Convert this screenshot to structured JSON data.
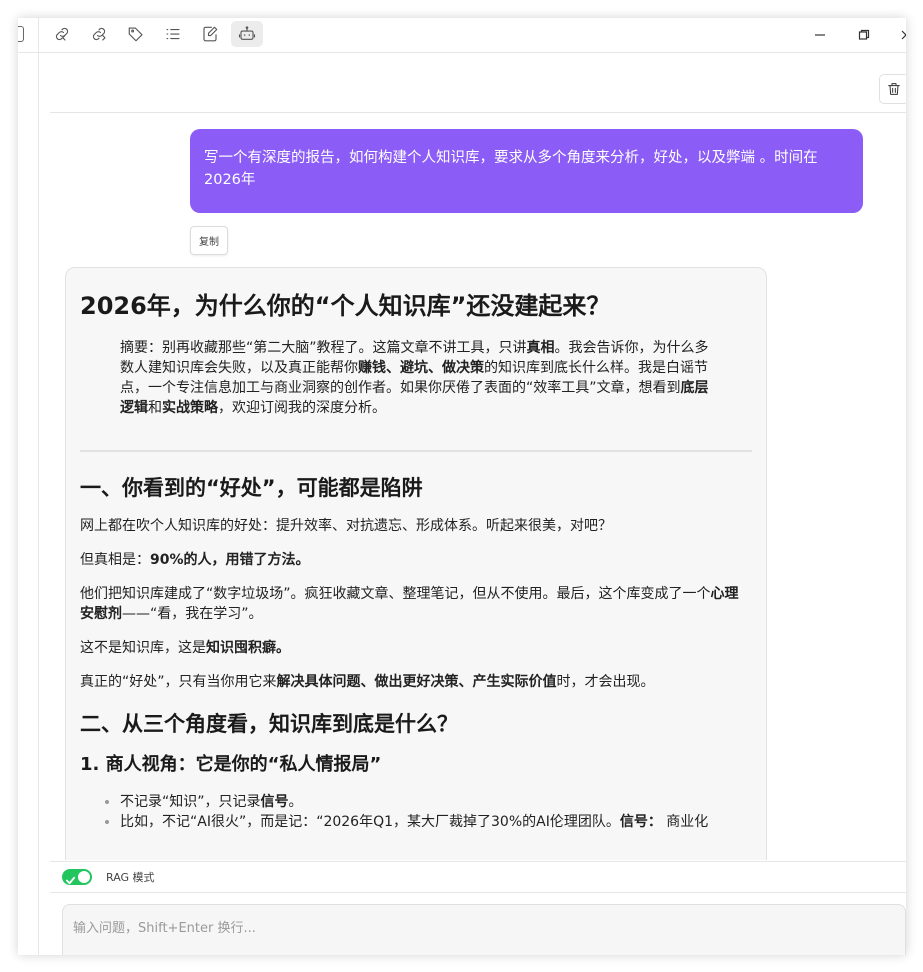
{
  "toolbar": {
    "buttons": [
      {
        "icon": "link-in-icon"
      },
      {
        "icon": "link-out-icon"
      },
      {
        "icon": "tag-icon"
      },
      {
        "icon": "list-icon"
      },
      {
        "icon": "edit-note-icon"
      },
      {
        "icon": "robot-icon",
        "active": true
      }
    ],
    "window_controls": [
      "minimize-icon",
      "restore-icon",
      "close-icon"
    ]
  },
  "chat": {
    "user_message": "写一个有深度的报告，如何构建个人知识库，要求从多个角度来分析，好处，以及弊端 。时间在2026年",
    "copy_label": "复制",
    "answer": {
      "title": "2026年，为什么你的“个人知识库”还没建起来？",
      "abstract": {
        "p1": "摘要：别再收藏那些“第二大脑”教程了。这篇文章不讲工具，只讲",
        "b1": "真相",
        "p2": "。我会告诉你，为什么多数人建知识库会失败，以及真正能帮你",
        "b2": "赚钱、避坑、做决策",
        "p3": "的知识库到底长什么样。我是白谣节点，一个专注信息加工与商业洞察的创作者。如果你厌倦了表面的“效率工具”文章，想看到",
        "b3": "底层逻辑",
        "p4": "和",
        "b4": "实战策略",
        "p5": "，欢迎订阅我的深度分析。"
      },
      "section1": {
        "heading": "一、你看到的“好处”，可能都是陷阱",
        "para1": "网上都在吹个人知识库的好处：提升效率、对抗遗忘、形成体系。听起来很美，对吧？",
        "para2_pre": "但真相是：",
        "para2_bold": "90%的人，用错了方法。",
        "para3_pre": "他们把知识库建成了“数字垃圾场”。疯狂收藏文章、整理笔记，但从不使用。最后，这个库变成了一个",
        "para3_bold": "心理安慰剂",
        "para3_post": "——“看，我在学习”。",
        "para4_pre": "这不是知识库，这是",
        "para4_bold": "知识囤积癖。",
        "para5_pre": "真正的“好处”，只有当你用它来",
        "para5_bold": "解决具体问题、做出更好决策、产生实际价值",
        "para5_post": "时，才会出现。"
      },
      "section2": {
        "heading": "二、从三个角度看，知识库到底是什么？",
        "sub1": "1. 商人视角：它是你的“私人情报局”",
        "bullet1_pre": "不记录“知识”，只记录",
        "bullet1_bold": "信号",
        "bullet1_post": "。",
        "bullet2_pre": "比如，不记“AI很火”，而是记：“2026年Q1，某大厂裁掉了30%的AI伦理团队。",
        "bullet2_bold": "信号：",
        "bullet2_post": " 商业化"
      }
    }
  },
  "footer": {
    "rag_label": "RAG 模式",
    "rag_enabled": true,
    "input_placeholder": "输入问题，Shift+Enter 换行..."
  }
}
